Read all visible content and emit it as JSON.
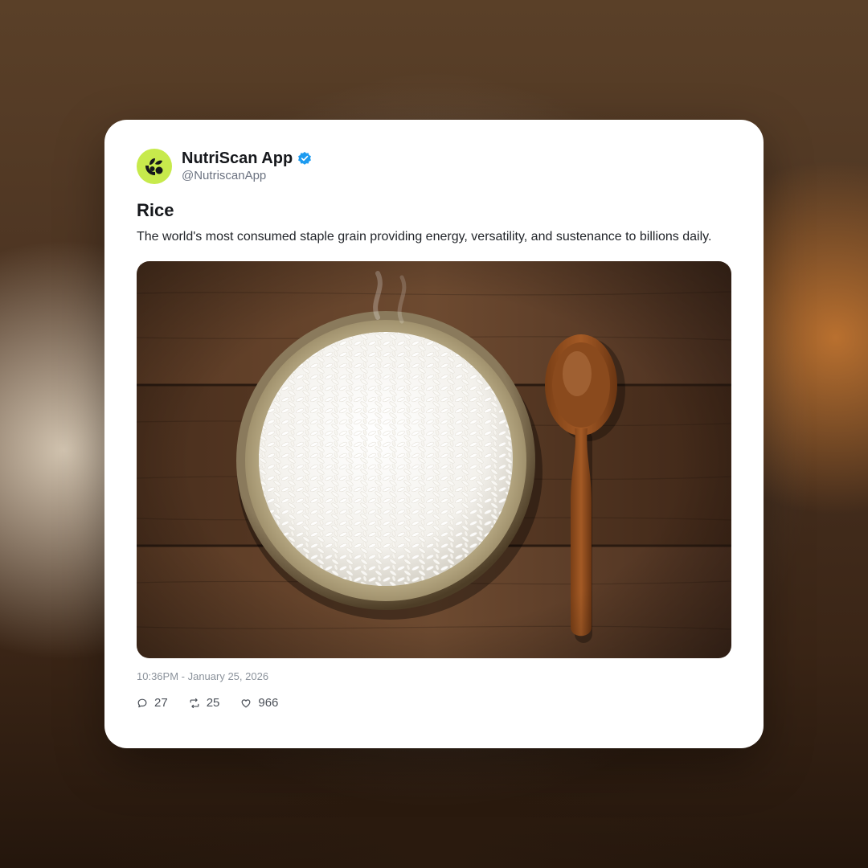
{
  "post": {
    "author": {
      "display_name": "NutriScan App",
      "handle": "@NutriscanApp",
      "verified": true,
      "avatar_icon": "nutriscan-logo-icon",
      "avatar_color": "#c7ea4c"
    },
    "title": "Rice",
    "description": "The world's most consumed staple grain providing energy, versatility, and sustenance to billions daily.",
    "media": {
      "subject": "bowl of white rice with wooden spoon on wooden table"
    },
    "timestamp": "10:36PM - January 25, 2026",
    "stats": {
      "replies": "27",
      "reposts": "25",
      "likes": "966"
    },
    "icons": {
      "reply": "comment-icon",
      "repost": "repost-icon",
      "like": "heart-icon",
      "verified": "verified-badge-icon"
    },
    "colors": {
      "verified": "#1d9bf0",
      "text_primary": "#16181c",
      "text_secondary": "#6b7280"
    }
  }
}
